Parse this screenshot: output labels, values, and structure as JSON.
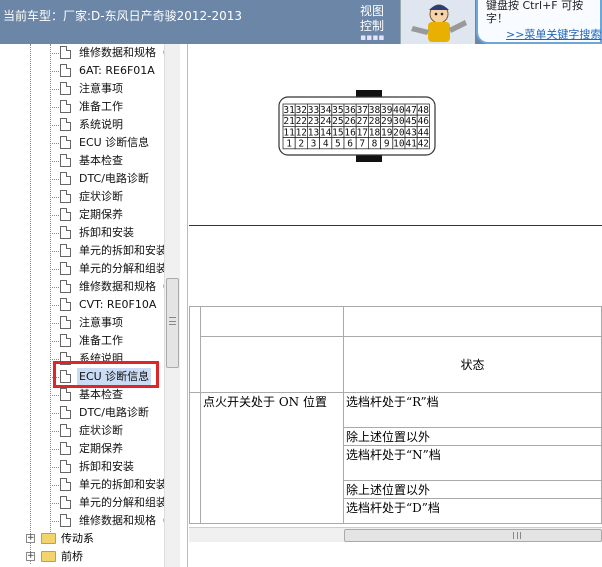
{
  "header": {
    "title": "当前车型：厂家:D-东风日产奇骏2012-2013",
    "view_control": [
      "视图",
      "控制"
    ],
    "shortcut": {
      "line1": "键盘按  Ctrl+F  可按",
      "line2": "字！",
      "link": ">>菜单关键字搜索"
    }
  },
  "sidebar": {
    "items": [
      "维修数据和规格（",
      "6AT: RE6F01A",
      "注意事项",
      "准备工作",
      "系统说明",
      "ECU 诊断信息",
      "基本检查",
      "DTC/电路诊断",
      "症状诊断",
      "定期保养",
      "拆卸和安装",
      "单元的拆卸和安装",
      "单元的分解和组装",
      "维修数据和规格（",
      "CVT: RE0F10A",
      "注意事项",
      "准备工作",
      "系统说明",
      "ECU 诊断信息",
      "基本检查",
      "DTC/电路诊断",
      "症状诊断",
      "定期保养",
      "拆卸和安装",
      "单元的拆卸和安装",
      "单元的分解和组装",
      "维修数据和规格（"
    ],
    "selected_index": 18,
    "categories": [
      "传动系",
      "前桥"
    ]
  },
  "connector": {
    "rows": [
      [
        "31",
        "32",
        "33",
        "34",
        "35",
        "36",
        "37",
        "38",
        "39",
        "40",
        "47",
        "48"
      ],
      [
        "21",
        "22",
        "23",
        "24",
        "25",
        "26",
        "27",
        "28",
        "29",
        "30",
        "45",
        "46"
      ],
      [
        "11",
        "12",
        "13",
        "14",
        "15",
        "16",
        "17",
        "18",
        "19",
        "20",
        "43",
        "44"
      ],
      [
        "1",
        "2",
        "3",
        "4",
        "5",
        "6",
        "7",
        "8",
        "9",
        "10",
        "41",
        "42"
      ]
    ]
  },
  "table": {
    "header_status": "状态",
    "condition": "点火开关处于 ON 位置",
    "states": [
      "选档杆处于“R”档",
      "除上述位置以外",
      "选档杆处于“N”档",
      "除上述位置以外",
      "选档杆处于“D”档"
    ]
  }
}
